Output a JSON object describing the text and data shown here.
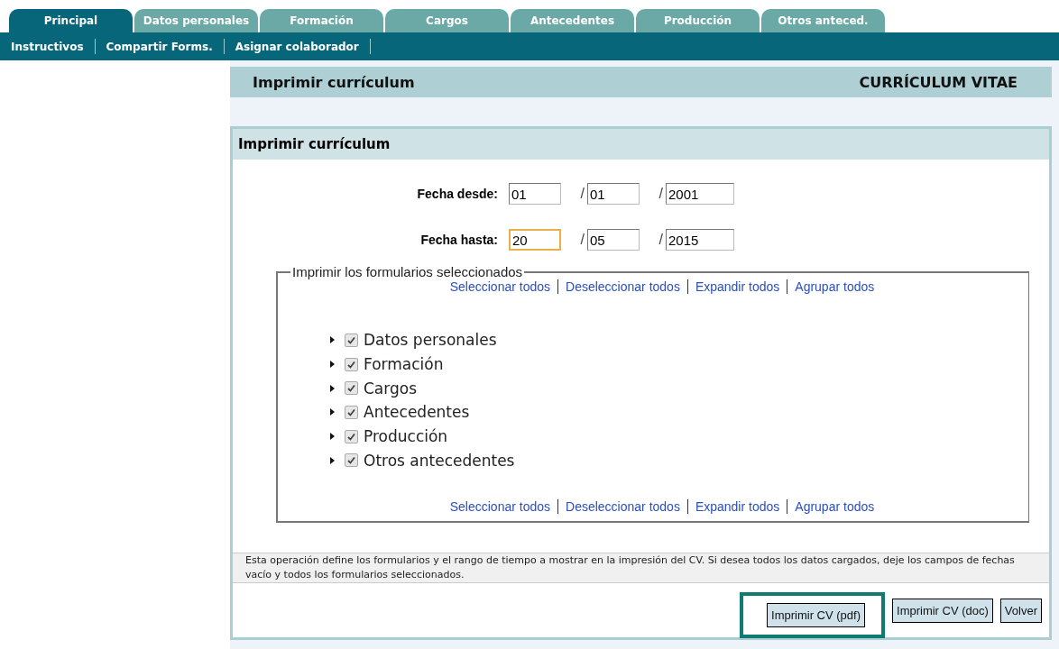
{
  "tabs": [
    {
      "label": "Principal",
      "selected": true
    },
    {
      "label": "Datos personales",
      "selected": false
    },
    {
      "label": "Formación",
      "selected": false
    },
    {
      "label": "Cargos",
      "selected": false
    },
    {
      "label": "Antecedentes",
      "selected": false
    },
    {
      "label": "Producción",
      "selected": false
    },
    {
      "label": "Otros anteced.",
      "selected": false
    }
  ],
  "subnav": [
    "Instructivos",
    "Compartir Forms.",
    "Asignar colaborador"
  ],
  "page_header": {
    "title": "Imprimir currículum",
    "right_title": "CURRÍCULUM VITAE"
  },
  "panel": {
    "title": "Imprimir currículum",
    "date_rows": [
      {
        "label": "Fecha desde:",
        "fields": [
          {
            "value": "01",
            "focused": false
          },
          {
            "value": "01",
            "focused": false
          },
          {
            "value": "2001",
            "focused": false
          }
        ]
      },
      {
        "label": "Fecha hasta:",
        "fields": [
          {
            "value": "20",
            "focused": true
          },
          {
            "value": "05",
            "focused": false
          },
          {
            "value": "2015",
            "focused": false
          }
        ]
      }
    ],
    "separator": "/",
    "fieldset": {
      "legend": "Imprimir los formularios seleccionados",
      "links_top": [
        "Seleccionar todos",
        "Deseleccionar todos",
        "Expandir todos",
        "Agrupar todos"
      ],
      "forms": [
        {
          "label": "Datos personales",
          "checked": true,
          "expanded": false
        },
        {
          "label": "Formación",
          "checked": true,
          "expanded": false
        },
        {
          "label": "Cargos",
          "checked": true,
          "expanded": false
        },
        {
          "label": "Antecedentes",
          "checked": true,
          "expanded": false
        },
        {
          "label": "Producción",
          "checked": true,
          "expanded": false
        },
        {
          "label": "Otros antecedentes",
          "checked": true,
          "expanded": false
        }
      ],
      "links_bottom": [
        "Seleccionar todos",
        "Deseleccionar todos",
        "Expandir todos",
        "Agrupar todos"
      ]
    },
    "note": "Esta operación define los formularios y el rango de tiempo a mostrar en la impresión del CV. Si desea todos los datos cargados, deje los campos de fechas vacío y todos los formularios seleccionados.",
    "buttons": [
      {
        "label": "Imprimir CV (pdf)",
        "highlighted": true
      },
      {
        "label": "Imprimir CV (doc)",
        "highlighted": false
      },
      {
        "label": "Volver",
        "highlighted": false
      }
    ]
  }
}
